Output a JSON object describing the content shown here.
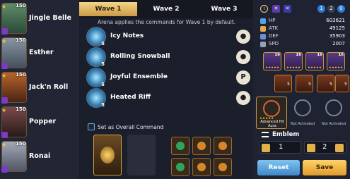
{
  "heroes": [
    {
      "name": "Jingle Belle",
      "level": "150",
      "color": "#3f6b4e"
    },
    {
      "name": "Esther",
      "level": "150",
      "color": "#6d7a88"
    },
    {
      "name": "Jack'n Roll",
      "level": "150",
      "color": "#8a4a2a"
    },
    {
      "name": "Popper",
      "level": "150",
      "color": "#5a3a3a"
    },
    {
      "name": "Ronai",
      "level": "150",
      "color": "#7a7f90"
    }
  ],
  "tabs": [
    "Wave 1",
    "Wave 2",
    "Wave 3"
  ],
  "info_text": "Arena applies the commands for Wave 1 by default.",
  "commands": [
    {
      "name": "Icy Notes",
      "num": "5",
      "button": "person"
    },
    {
      "name": "Rolling Snowball",
      "num": "5",
      "button": "person"
    },
    {
      "name": "Joyful Ensemble",
      "num": "5",
      "button": "P"
    },
    {
      "name": "Heated Riff",
      "num": "5",
      "button": "person"
    }
  ],
  "overall_label": "Set as Overall Command",
  "top_counts": [
    "1",
    "2",
    "0"
  ],
  "stats": [
    {
      "label": "HP",
      "value": "603621",
      "color": "#4fa7e8"
    },
    {
      "label": "ATK",
      "value": "49125",
      "color": "#e8a74f"
    },
    {
      "label": "DEF",
      "value": "35903",
      "color": "#6a8fd8"
    },
    {
      "label": "SPD",
      "value": "2007",
      "color": "#9aa2b8"
    }
  ],
  "equip_levels": [
    "16",
    "16",
    "16",
    "16"
  ],
  "gear_levels": [
    "5",
    "5",
    "5",
    "5"
  ],
  "artifacts": [
    {
      "label": "Advanced Hit Aura",
      "stars": "★★★★★"
    },
    {
      "label": "Not Activated"
    },
    {
      "label": "Not Activated"
    }
  ],
  "emblem_title": "Emblem",
  "emblem_values": [
    "1",
    "2"
  ],
  "reset_label": "Reset",
  "save_label": "Save"
}
